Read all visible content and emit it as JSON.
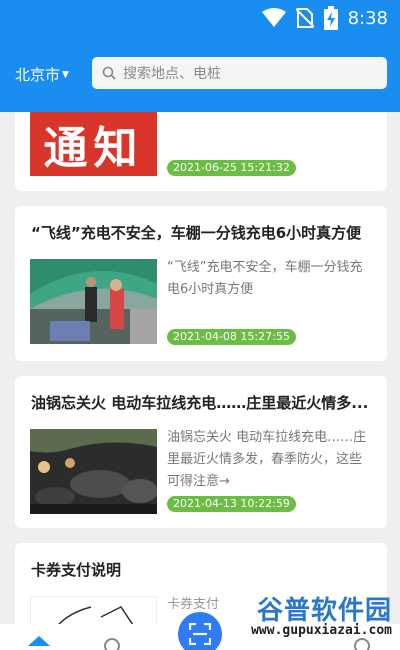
{
  "status": {
    "time": "8:38"
  },
  "header": {
    "city": "北京市",
    "search_placeholder": "搜索地点、电桩"
  },
  "articles": [
    {
      "thumb_text": "通知",
      "time": "2021-06-25 15:21:32"
    },
    {
      "title": "“飞线”充电不安全，车棚一分钱充电6小时真方便",
      "excerpt": "“飞线”充电不安全，车棚一分钱充电6小时真方便",
      "time": "2021-04-08 15:27:55"
    },
    {
      "title": "油锅忘关火 电动车拉线充电……庄里最近火情多...",
      "excerpt": "油锅忘关火 电动车拉线充电……庄里最近火情多发，春季防火，这些可得注意→",
      "time": "2021-04-13 10:22:59"
    },
    {
      "title": "卡券支付说明",
      "excerpt": "卡券支付"
    }
  ],
  "watermark": {
    "name": "谷普软件园",
    "url": "www.gupuxiazai.com"
  },
  "colors": {
    "header": "#1a8df0",
    "badge": "#6dbd45",
    "notice": "#d8362a",
    "fab": "#2f7cf2"
  }
}
